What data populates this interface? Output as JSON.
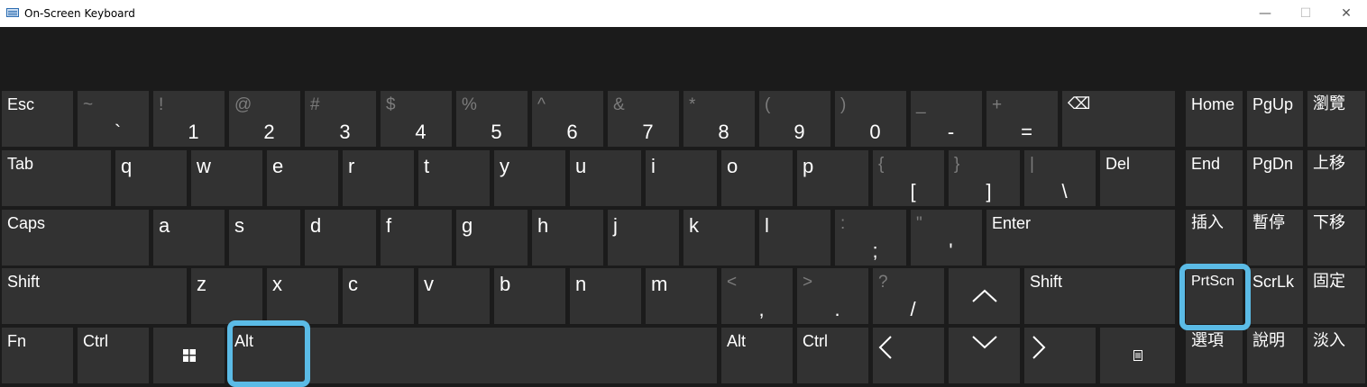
{
  "window": {
    "title": "On-Screen Keyboard",
    "controls": {
      "minimize": "—",
      "maximize": "☐",
      "close": "✕"
    }
  },
  "keys": {
    "esc": "Esc",
    "tilde": {
      "top": "~",
      "bottom": "`"
    },
    "d1": {
      "top": "!",
      "bottom": "1"
    },
    "d2": {
      "top": "@",
      "bottom": "2"
    },
    "d3": {
      "top": "#",
      "bottom": "3"
    },
    "d4": {
      "top": "$",
      "bottom": "4"
    },
    "d5": {
      "top": "%",
      "bottom": "5"
    },
    "d6": {
      "top": "^",
      "bottom": "6"
    },
    "d7": {
      "top": "&",
      "bottom": "7"
    },
    "d8": {
      "top": "*",
      "bottom": "8"
    },
    "d9": {
      "top": "(",
      "bottom": "9"
    },
    "d0": {
      "top": ")",
      "bottom": "0"
    },
    "minus": {
      "top": "_",
      "bottom": "-"
    },
    "equals": {
      "top": "+",
      "bottom": "="
    },
    "backspace": "⌫",
    "home": "Home",
    "pgup": "PgUp",
    "browse": "瀏覽",
    "tab": "Tab",
    "q": "q",
    "w": "w",
    "e": "e",
    "r": "r",
    "t": "t",
    "y": "y",
    "u": "u",
    "i": "i",
    "o": "o",
    "p": "p",
    "lbracket": {
      "top": "{",
      "bottom": "["
    },
    "rbracket": {
      "top": "}",
      "bottom": "]"
    },
    "backslash": {
      "top": "|",
      "bottom": "\\"
    },
    "del": "Del",
    "end": "End",
    "pgdn": "PgDn",
    "moveup": "上移",
    "caps": "Caps",
    "a": "a",
    "s": "s",
    "d": "d",
    "f": "f",
    "g": "g",
    "h": "h",
    "j": "j",
    "k": "k",
    "l": "l",
    "semicolon": {
      "top": ":",
      "bottom": ";"
    },
    "quote": {
      "top": "\"",
      "bottom": "'"
    },
    "enter": "Enter",
    "insert": "插入",
    "pause": "暫停",
    "movedown": "下移",
    "shift_left": "Shift",
    "z": "z",
    "x": "x",
    "c": "c",
    "v": "v",
    "b": "b",
    "n": "n",
    "m": "m",
    "comma": {
      "top": "<",
      "bottom": ","
    },
    "period": {
      "top": ">",
      "bottom": "."
    },
    "slash": {
      "top": "?",
      "bottom": "/"
    },
    "up_arrow": "⌃",
    "shift_right": "Shift",
    "prtscn": "PrtScn",
    "scrlk": "ScrLk",
    "dock": "固定",
    "fn": "Fn",
    "ctrl_left": "Ctrl",
    "alt_left": "Alt",
    "alt_right": "Alt",
    "ctrl_right": "Ctrl",
    "left_arrow": "〈",
    "down_arrow": "⌄",
    "right_arrow": "〉",
    "options": "選項",
    "help": "說明",
    "fade": "淡入"
  },
  "colors": {
    "background": "#1b1b1b",
    "key": "#323232",
    "shifted_text": "#7c7c7c",
    "highlight": "#5bbbe6"
  },
  "icons": {
    "windows": "windows-logo-icon",
    "menu": "context-menu-icon",
    "backspace": "backspace-icon"
  }
}
